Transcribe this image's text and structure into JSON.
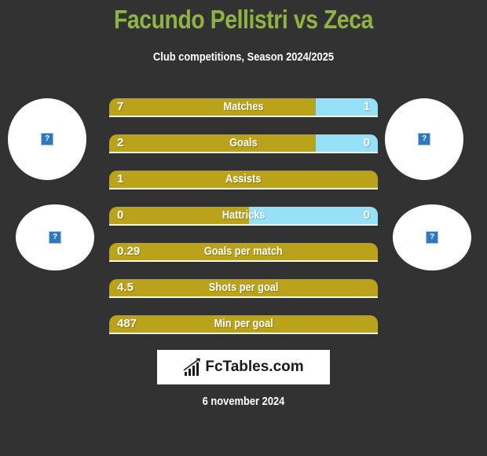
{
  "header": {
    "title": "Facundo Pellistri vs Zeca",
    "subtitle": "Club competitions, Season 2024/2025"
  },
  "players": {
    "left": {
      "name": "Facundo Pellistri",
      "avatar_icon": "missing-image-icon",
      "club_icon": "missing-image-icon"
    },
    "right": {
      "name": "Zeca",
      "avatar_icon": "missing-image-icon",
      "club_icon": "missing-image-icon"
    }
  },
  "colors": {
    "left_bar": "#baa21b",
    "right_bar": "#97e1f8",
    "title": "#8fb442",
    "background": "#323232"
  },
  "stats": [
    {
      "label": "Matches",
      "left": "7",
      "right": "1",
      "right_share": 0.23
    },
    {
      "label": "Goals",
      "left": "2",
      "right": "0",
      "right_share": 0.23
    },
    {
      "label": "Assists",
      "left": "1",
      "right": "",
      "right_share": 0
    },
    {
      "label": "Hattricks",
      "left": "0",
      "right": "0",
      "right_share": 0.48
    },
    {
      "label": "Goals per match",
      "left": "0.29",
      "right": "",
      "right_share": 0
    },
    {
      "label": "Shots per goal",
      "left": "4.5",
      "right": "",
      "right_share": 0
    },
    {
      "label": "Min per goal",
      "left": "487",
      "right": "",
      "right_share": 0
    }
  ],
  "footer": {
    "logo_text": "FcTables.com",
    "date": "6 november 2024"
  }
}
